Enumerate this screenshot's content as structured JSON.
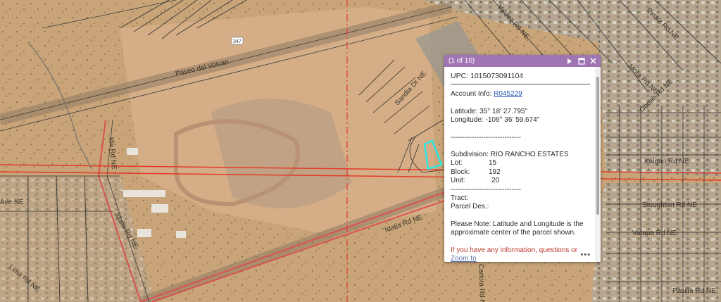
{
  "map": {
    "labels": {
      "paseo": "Paseo del Volcan",
      "route": "347",
      "idalia_left": "Idalia Rd NE",
      "idalia_center": "Idalia Rd NE",
      "ave": "Ave NE",
      "lima": "Lima Rd NE",
      "ida": "Ida Rd NE",
      "sandia_dr": "Sandia Dr NE",
      "calle": "Carlota Rd NE",
      "valdez": "Valdez Rd NE",
      "pinaiz": "Pinaiz Rd NE",
      "mora": "Mora Rd NE",
      "obeah": "Obeah Rd NE",
      "kalgan": "Kalgan Rd NE",
      "stoughton": "Stoughton Rd NE",
      "vatapa": "Vatapa Rd NE",
      "pasilla": "Pasilla Rd NE"
    }
  },
  "popup": {
    "count": "(1 of 10)",
    "icons": [
      "play-icon",
      "maximize-icon",
      "close-icon"
    ],
    "upc": "UPC: 1015073091104",
    "account_label": "Account Info: ",
    "account_link": "R045229",
    "latitude": "Latitude: 35° 18' 27.795\"",
    "longitude": "Longitude: -106° 36' 59.674\"",
    "separator1": "------------------------------",
    "subdivision": "Subdivision: RIO RANCHO ESTATES",
    "lot_label": "Lot:",
    "lot_value": "15",
    "block_label": "Block:",
    "block_value": "192",
    "unit_label": "Unit:",
    "unit_value": "20",
    "separator2": "------------------------------",
    "tract": "Tract:",
    "parcel_des": "Parcel Des.:",
    "note": "Please Note: Latitude and Longitude is the approximate center of the parcel shown.",
    "info_text": "If you have any information, questions or",
    "zoom_link": "Zoom to",
    "more": "•••"
  },
  "colors": {
    "header": "#a075b3",
    "parcel_line": "#333333",
    "highlight": "#2ee6e0",
    "road_red": "#d9534f",
    "zoning_red": "#e43b2a"
  }
}
